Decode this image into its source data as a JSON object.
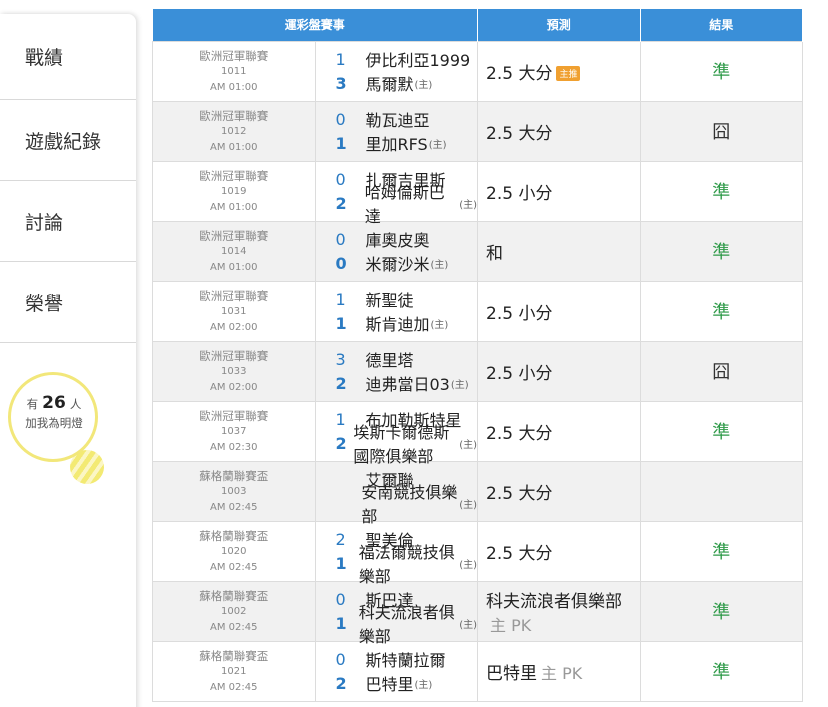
{
  "sidebar": {
    "items": [
      {
        "label": "戰績"
      },
      {
        "label": "遊戲紀錄"
      },
      {
        "label": "討論"
      },
      {
        "label": "榮譽"
      }
    ],
    "likes": {
      "prefix": "有",
      "count": "26",
      "suffix": "人",
      "line2": "加我為明燈"
    }
  },
  "table": {
    "headers": {
      "event": "運彩盤賽事",
      "prediction": "預測",
      "result": "結果"
    },
    "home_mark": "(主)",
    "rows": [
      {
        "league": "歐洲冠軍聯賽",
        "code": "1011",
        "time": "AM 01:00",
        "away_score": "1",
        "away": "伊比利亞1999",
        "home_score": "3",
        "home": "馬爾默",
        "prediction": "2.5 大分",
        "tag": "主推",
        "pk": "",
        "result": "準"
      },
      {
        "league": "歐洲冠軍聯賽",
        "code": "1012",
        "time": "AM 01:00",
        "away_score": "0",
        "away": "勒瓦迪亞",
        "home_score": "1",
        "home": "里加RFS",
        "prediction": "2.5 大分",
        "tag": "",
        "pk": "",
        "result": "囧"
      },
      {
        "league": "歐洲冠軍聯賽",
        "code": "1019",
        "time": "AM 01:00",
        "away_score": "0",
        "away": "扎爾吉里斯",
        "home_score": "2",
        "home": "哈姆倫斯巴達",
        "prediction": "2.5 小分",
        "tag": "",
        "pk": "",
        "result": "準"
      },
      {
        "league": "歐洲冠軍聯賽",
        "code": "1014",
        "time": "AM 01:00",
        "away_score": "0",
        "away": "庫奧皮奧",
        "home_score": "0",
        "home": "米爾沙米",
        "prediction": "和",
        "tag": "",
        "pk": "",
        "result": "準"
      },
      {
        "league": "歐洲冠軍聯賽",
        "code": "1031",
        "time": "AM 02:00",
        "away_score": "1",
        "away": "新聖徒",
        "home_score": "1",
        "home": "斯肯迪加",
        "prediction": "2.5 小分",
        "tag": "",
        "pk": "",
        "result": "準"
      },
      {
        "league": "歐洲冠軍聯賽",
        "code": "1033",
        "time": "AM 02:00",
        "away_score": "3",
        "away": "德里塔",
        "home_score": "2",
        "home": "迪弗當日03",
        "prediction": "2.5 小分",
        "tag": "",
        "pk": "",
        "result": "囧"
      },
      {
        "league": "歐洲冠軍聯賽",
        "code": "1037",
        "time": "AM 02:30",
        "away_score": "1",
        "away": "布加勒斯特星",
        "home_score": "2",
        "home": "埃斯卡爾德斯國際俱樂部",
        "prediction": "2.5 大分",
        "tag": "",
        "pk": "",
        "result": "準"
      },
      {
        "league": "蘇格蘭聯賽盃",
        "code": "1003",
        "time": "AM 02:45",
        "away_score": "",
        "away": "艾爾聯",
        "home_score": "",
        "home": "安南競技俱樂部",
        "prediction": "2.5 大分",
        "tag": "",
        "pk": "",
        "result": ""
      },
      {
        "league": "蘇格蘭聯賽盃",
        "code": "1020",
        "time": "AM 02:45",
        "away_score": "2",
        "away": "聖美倫",
        "home_score": "1",
        "home": "福法爾競技俱樂部",
        "prediction": "2.5 大分",
        "tag": "",
        "pk": "",
        "result": "準"
      },
      {
        "league": "蘇格蘭聯賽盃",
        "code": "1002",
        "time": "AM 02:45",
        "away_score": "0",
        "away": "斯巴達",
        "home_score": "1",
        "home": "科夫流浪者俱樂部",
        "prediction": "科夫流浪者俱樂部",
        "tag": "",
        "pk": "主 PK",
        "result": "準"
      },
      {
        "league": "蘇格蘭聯賽盃",
        "code": "1021",
        "time": "AM 02:45",
        "away_score": "0",
        "away": "斯特蘭拉爾",
        "home_score": "2",
        "home": "巴特里",
        "prediction": "巴特里",
        "tag": "",
        "pk": "主 PK",
        "result": "準"
      }
    ]
  }
}
